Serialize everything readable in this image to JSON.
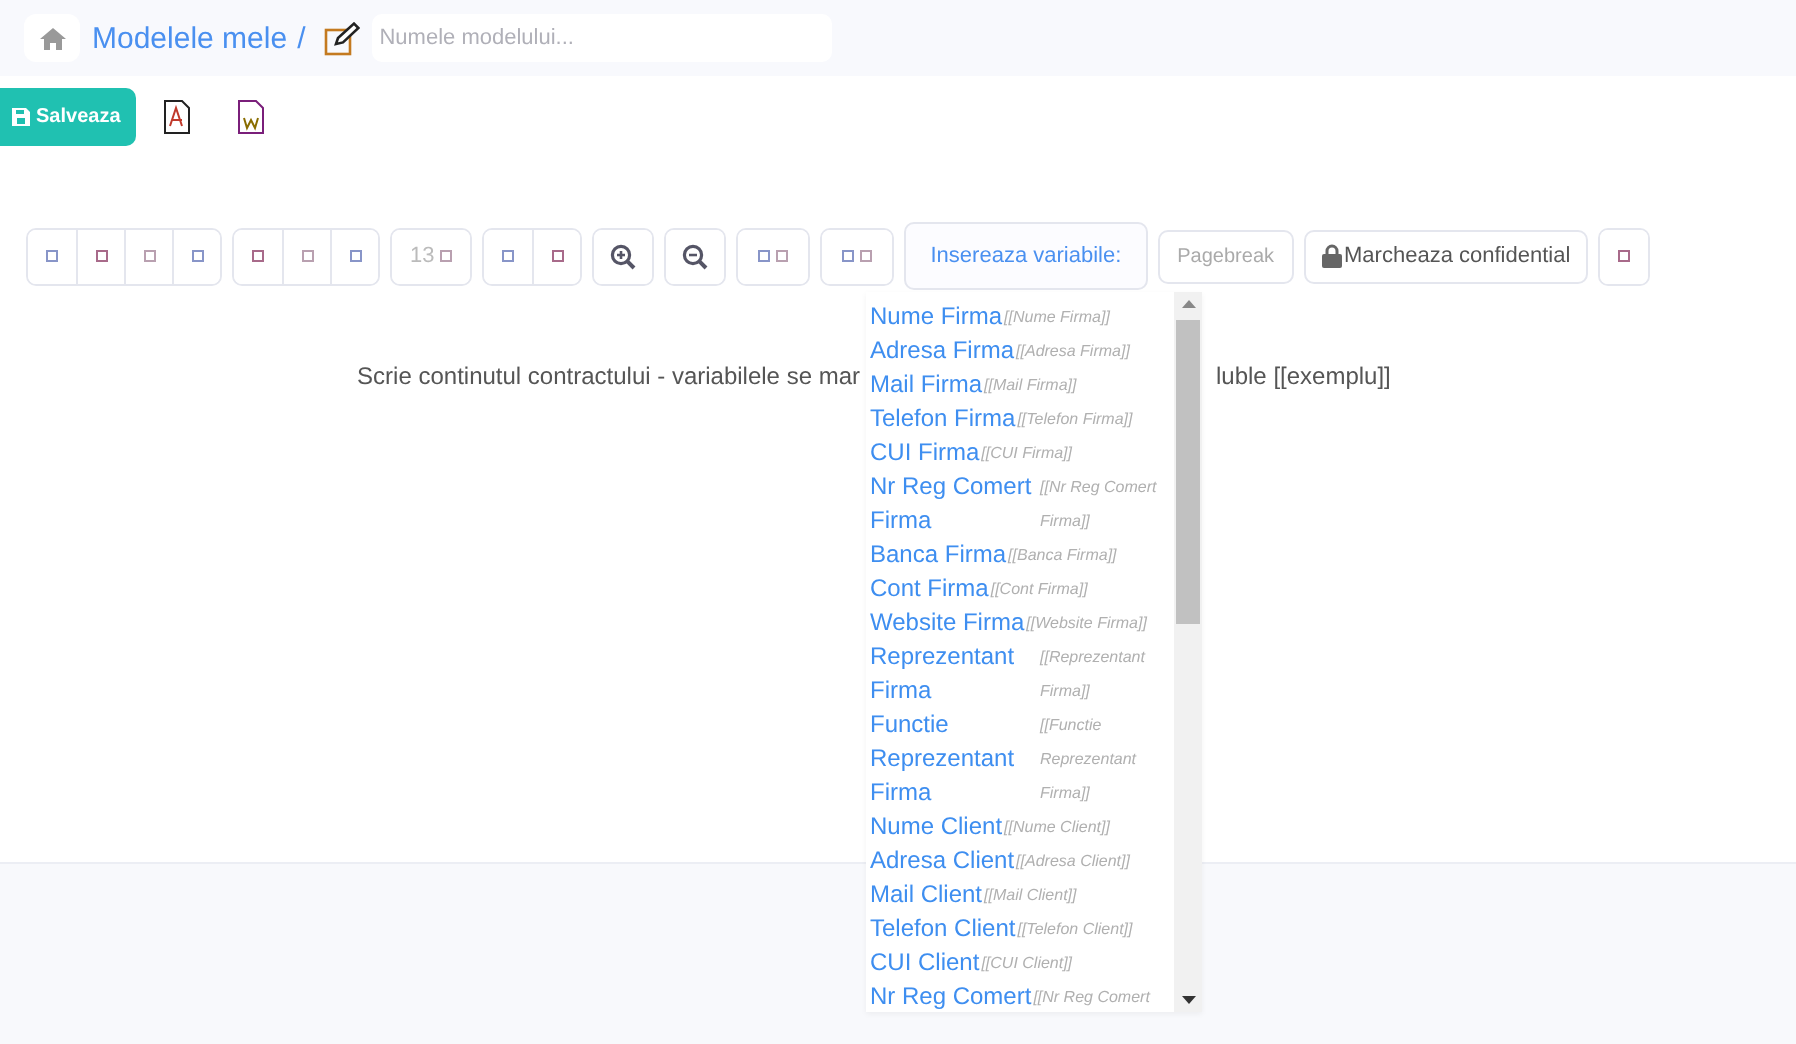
{
  "breadcrumb": {
    "link": "Modelele mele",
    "separator": "/",
    "name_field": {
      "placeholder": "Numele modelului..."
    }
  },
  "actions": {
    "save": "Salveaza"
  },
  "toolbar": {
    "groups": [
      {
        "buttons": [
          {
            "kind": "icon"
          },
          {
            "kind": "icon"
          },
          {
            "kind": "icon"
          },
          {
            "kind": "icon"
          }
        ]
      },
      {
        "buttons": [
          {
            "kind": "icon"
          },
          {
            "kind": "icon"
          },
          {
            "kind": "icon"
          }
        ]
      },
      {
        "buttons": [
          {
            "kind": "size",
            "label": "13"
          }
        ]
      },
      {
        "buttons": [
          {
            "kind": "icon"
          },
          {
            "kind": "icon"
          }
        ]
      },
      {
        "buttons": [
          {
            "kind": "zoom-in"
          }
        ]
      },
      {
        "buttons": [
          {
            "kind": "zoom-out"
          }
        ]
      },
      {
        "buttons": [
          {
            "kind": "double"
          }
        ]
      },
      {
        "buttons": [
          {
            "kind": "double"
          }
        ]
      }
    ],
    "insert_variable": "Insereaza variabile:",
    "pagebreak": "Pagebreak",
    "confidential": "Marcheaza confidential"
  },
  "editor": {
    "text_left": "Scrie continutul contractului - variabilele se mar",
    "text_right": "luble [[exemplu]]"
  },
  "variables": [
    {
      "label": "Nume Firma",
      "code": "[[Nume Firma]]"
    },
    {
      "label": "Adresa Firma",
      "code": "[[Adresa Firma]]"
    },
    {
      "label": "Mail Firma",
      "code": "[[Mail Firma]]"
    },
    {
      "label": "Telefon Firma",
      "code": "[[Telefon Firma]]"
    },
    {
      "label": "CUI Firma",
      "code": "[[CUI Firma]]"
    },
    {
      "label": "Nr Reg Comert Firma",
      "code": "[[Nr Reg Comert Firma]]"
    },
    {
      "label": "Banca Firma",
      "code": "[[Banca Firma]]"
    },
    {
      "label": "Cont Firma",
      "code": "[[Cont Firma]]"
    },
    {
      "label": "Website Firma",
      "code": "[[Website Firma]]"
    },
    {
      "label": "Reprezentant Firma",
      "code": "[[Reprezentant Firma]]"
    },
    {
      "label": "Functie Reprezentant Firma",
      "code": "[[Functie Reprezentant Firma]]"
    },
    {
      "label": "Nume Client",
      "code": "[[Nume Client]]"
    },
    {
      "label": "Adresa Client",
      "code": "[[Adresa Client]]"
    },
    {
      "label": "Mail Client",
      "code": "[[Mail Client]]"
    },
    {
      "label": "Telefon Client",
      "code": "[[Telefon Client]]"
    },
    {
      "label": "CUI Client",
      "code": "[[CUI Client]]"
    },
    {
      "label": "Nr Reg Comert",
      "code": "[[Nr Reg Comert"
    }
  ]
}
